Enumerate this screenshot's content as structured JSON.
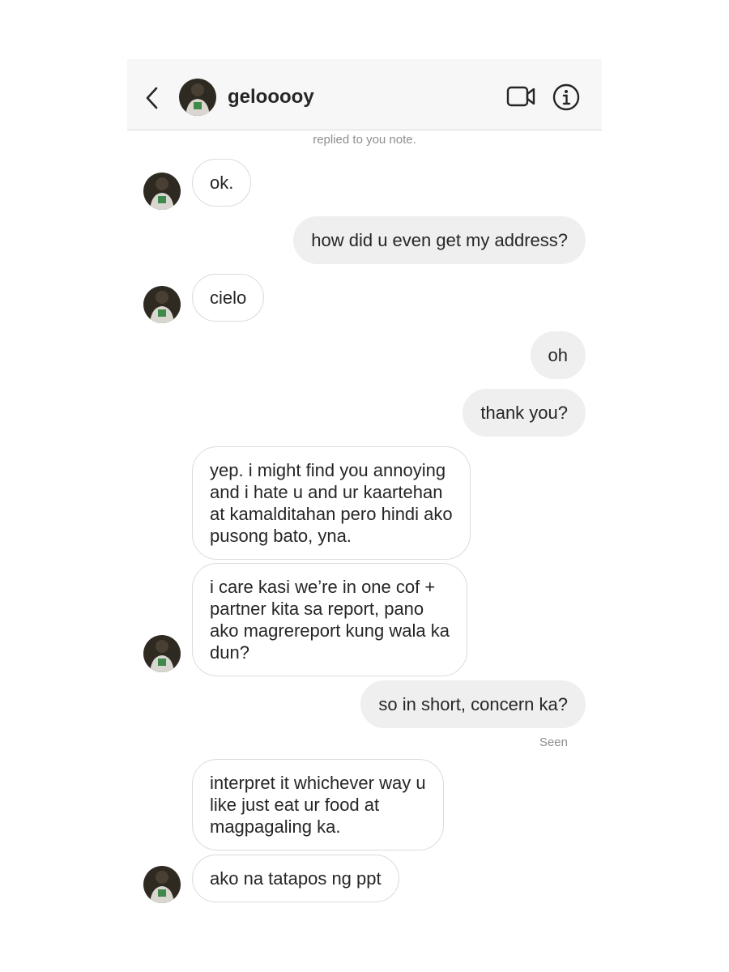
{
  "header": {
    "username": "gelooooy"
  },
  "icons": {
    "back": "chevron-left-icon",
    "video": "video-call-icon",
    "info": "info-icon"
  },
  "colors": {
    "header_bg": "#f7f7f7",
    "incoming_bubble_border": "#dbdbdb",
    "outgoing_bubble_bg": "#efefef",
    "meta_text": "#8e8e8e",
    "text": "#262626"
  },
  "thread": {
    "replied_note": "replied to you note.",
    "seen_label": "Seen",
    "messages": [
      {
        "from": "them",
        "lines": [
          "ok."
        ]
      },
      {
        "from": "me",
        "lines": [
          "how did u even get my address?"
        ]
      },
      {
        "from": "them",
        "lines": [
          "cielo"
        ]
      },
      {
        "from": "me",
        "lines": [
          "oh"
        ]
      },
      {
        "from": "me",
        "lines": [
          "thank you?"
        ]
      },
      {
        "from": "them",
        "lines": [
          "yep. i might find you annoying",
          "and i hate u and ur kaartehan",
          "at kamalditahan pero hindi ako",
          "pusong bato, yna."
        ]
      },
      {
        "from": "them",
        "lines": [
          "i care kasi we’re in one cof +",
          "partner kita sa report, pano",
          "ako magrereport kung wala ka",
          "dun?"
        ]
      },
      {
        "from": "me",
        "lines": [
          "so in short, concern ka?"
        ]
      },
      {
        "from": "them",
        "lines": [
          "interpret it whichever way u",
          "like just eat ur food at",
          "magpagaling ka."
        ]
      },
      {
        "from": "them",
        "lines": [
          "ako na tatapos ng ppt"
        ]
      }
    ]
  }
}
